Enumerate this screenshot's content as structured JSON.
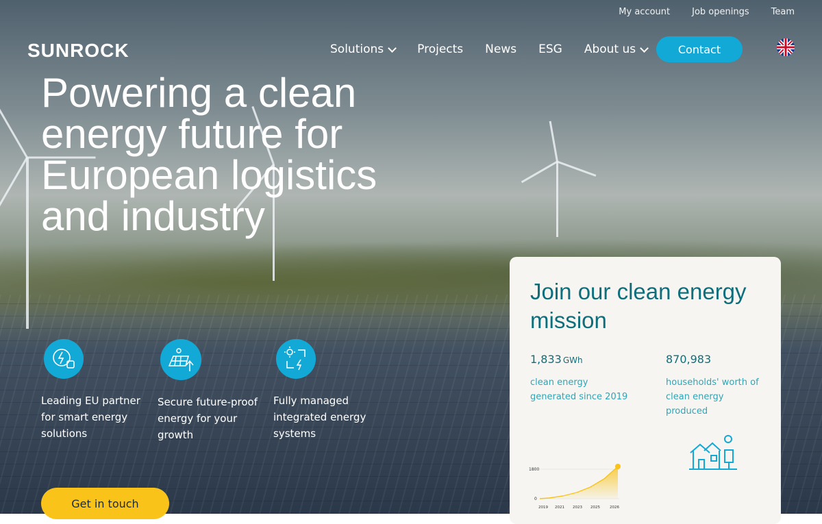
{
  "topbar": {
    "links": [
      "My account",
      "Job openings",
      "Team"
    ]
  },
  "brand": {
    "logo_text": "SUNROCK"
  },
  "nav": {
    "items": [
      {
        "label": "Solutions",
        "has_dropdown": true
      },
      {
        "label": "Projects",
        "has_dropdown": false
      },
      {
        "label": "News",
        "has_dropdown": false
      },
      {
        "label": "ESG",
        "has_dropdown": false
      },
      {
        "label": "About us",
        "has_dropdown": true
      }
    ],
    "contact_label": "Contact",
    "language_icon": "uk-flag-icon"
  },
  "hero": {
    "headline": "Powering a clean energy future for European logistics and industry",
    "features": [
      {
        "icon": "energy-partner-icon",
        "text": "Leading EU partner for smart energy solutions"
      },
      {
        "icon": "solar-panel-growth-icon",
        "text": "Secure future-proof energy for your growth"
      },
      {
        "icon": "managed-energy-system-icon",
        "text": "Fully managed integrated energy systems"
      }
    ],
    "cta_label": "Get in touch"
  },
  "card": {
    "title": "Join our clean energy mission",
    "stats": [
      {
        "value": "1,833",
        "unit": "GWh",
        "label": "clean energy generated since 2019"
      },
      {
        "value": "870,983",
        "unit": "",
        "label": "households' worth of clean energy produced"
      }
    ],
    "chart": {
      "y_ticks": [
        "1800",
        "0"
      ],
      "x_ticks": [
        "2019",
        "2021",
        "2023",
        "2025",
        "2026"
      ]
    },
    "house_icon": "households-icon"
  },
  "colors": {
    "accent": "#12a9d6",
    "cta": "#f9c31a",
    "card_text": "#0f6e7b",
    "card_bg": "#f6f5f2"
  }
}
